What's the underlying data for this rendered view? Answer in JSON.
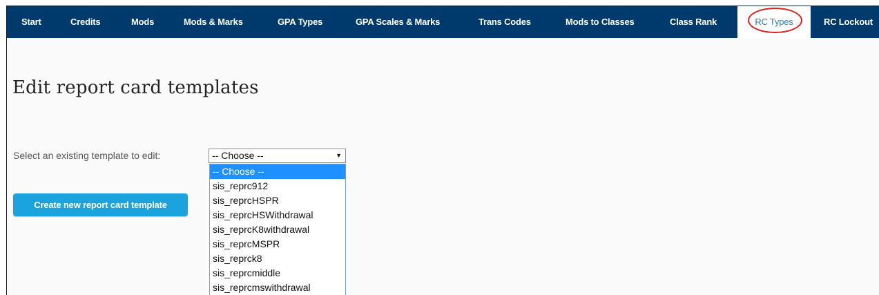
{
  "nav": {
    "items": [
      {
        "label": "Start"
      },
      {
        "label": "Credits"
      },
      {
        "label": "Mods"
      },
      {
        "label": "Mods & Marks"
      },
      {
        "label": "GPA Types"
      },
      {
        "label": "GPA Scales & Marks"
      },
      {
        "label": "Trans Codes"
      },
      {
        "label": "Mods to Classes"
      },
      {
        "label": "Class Rank"
      },
      {
        "label": "RC Types",
        "active": true
      },
      {
        "label": "RC Lockout"
      }
    ],
    "background_color": "#003a6c",
    "active_text_color": "#2c7fb8",
    "highlight_color": "#e0201a"
  },
  "page": {
    "title": "Edit report card templates"
  },
  "template_select": {
    "label": "Select an existing template to edit:",
    "value": "-- Choose --",
    "options": [
      "-- Choose --",
      "sis_reprc912",
      "sis_reprcHSPR",
      "sis_reprcHSWithdrawal",
      "sis_reprcK8withdrawal",
      "sis_reprcMSPR",
      "sis_reprck8",
      "sis_reprcmiddle",
      "sis_reprcmswithdrawal"
    ],
    "highlighted_option": "-- Choose --"
  },
  "actions": {
    "create_label": "Create new report card template",
    "create_color": "#1aa3dc"
  }
}
